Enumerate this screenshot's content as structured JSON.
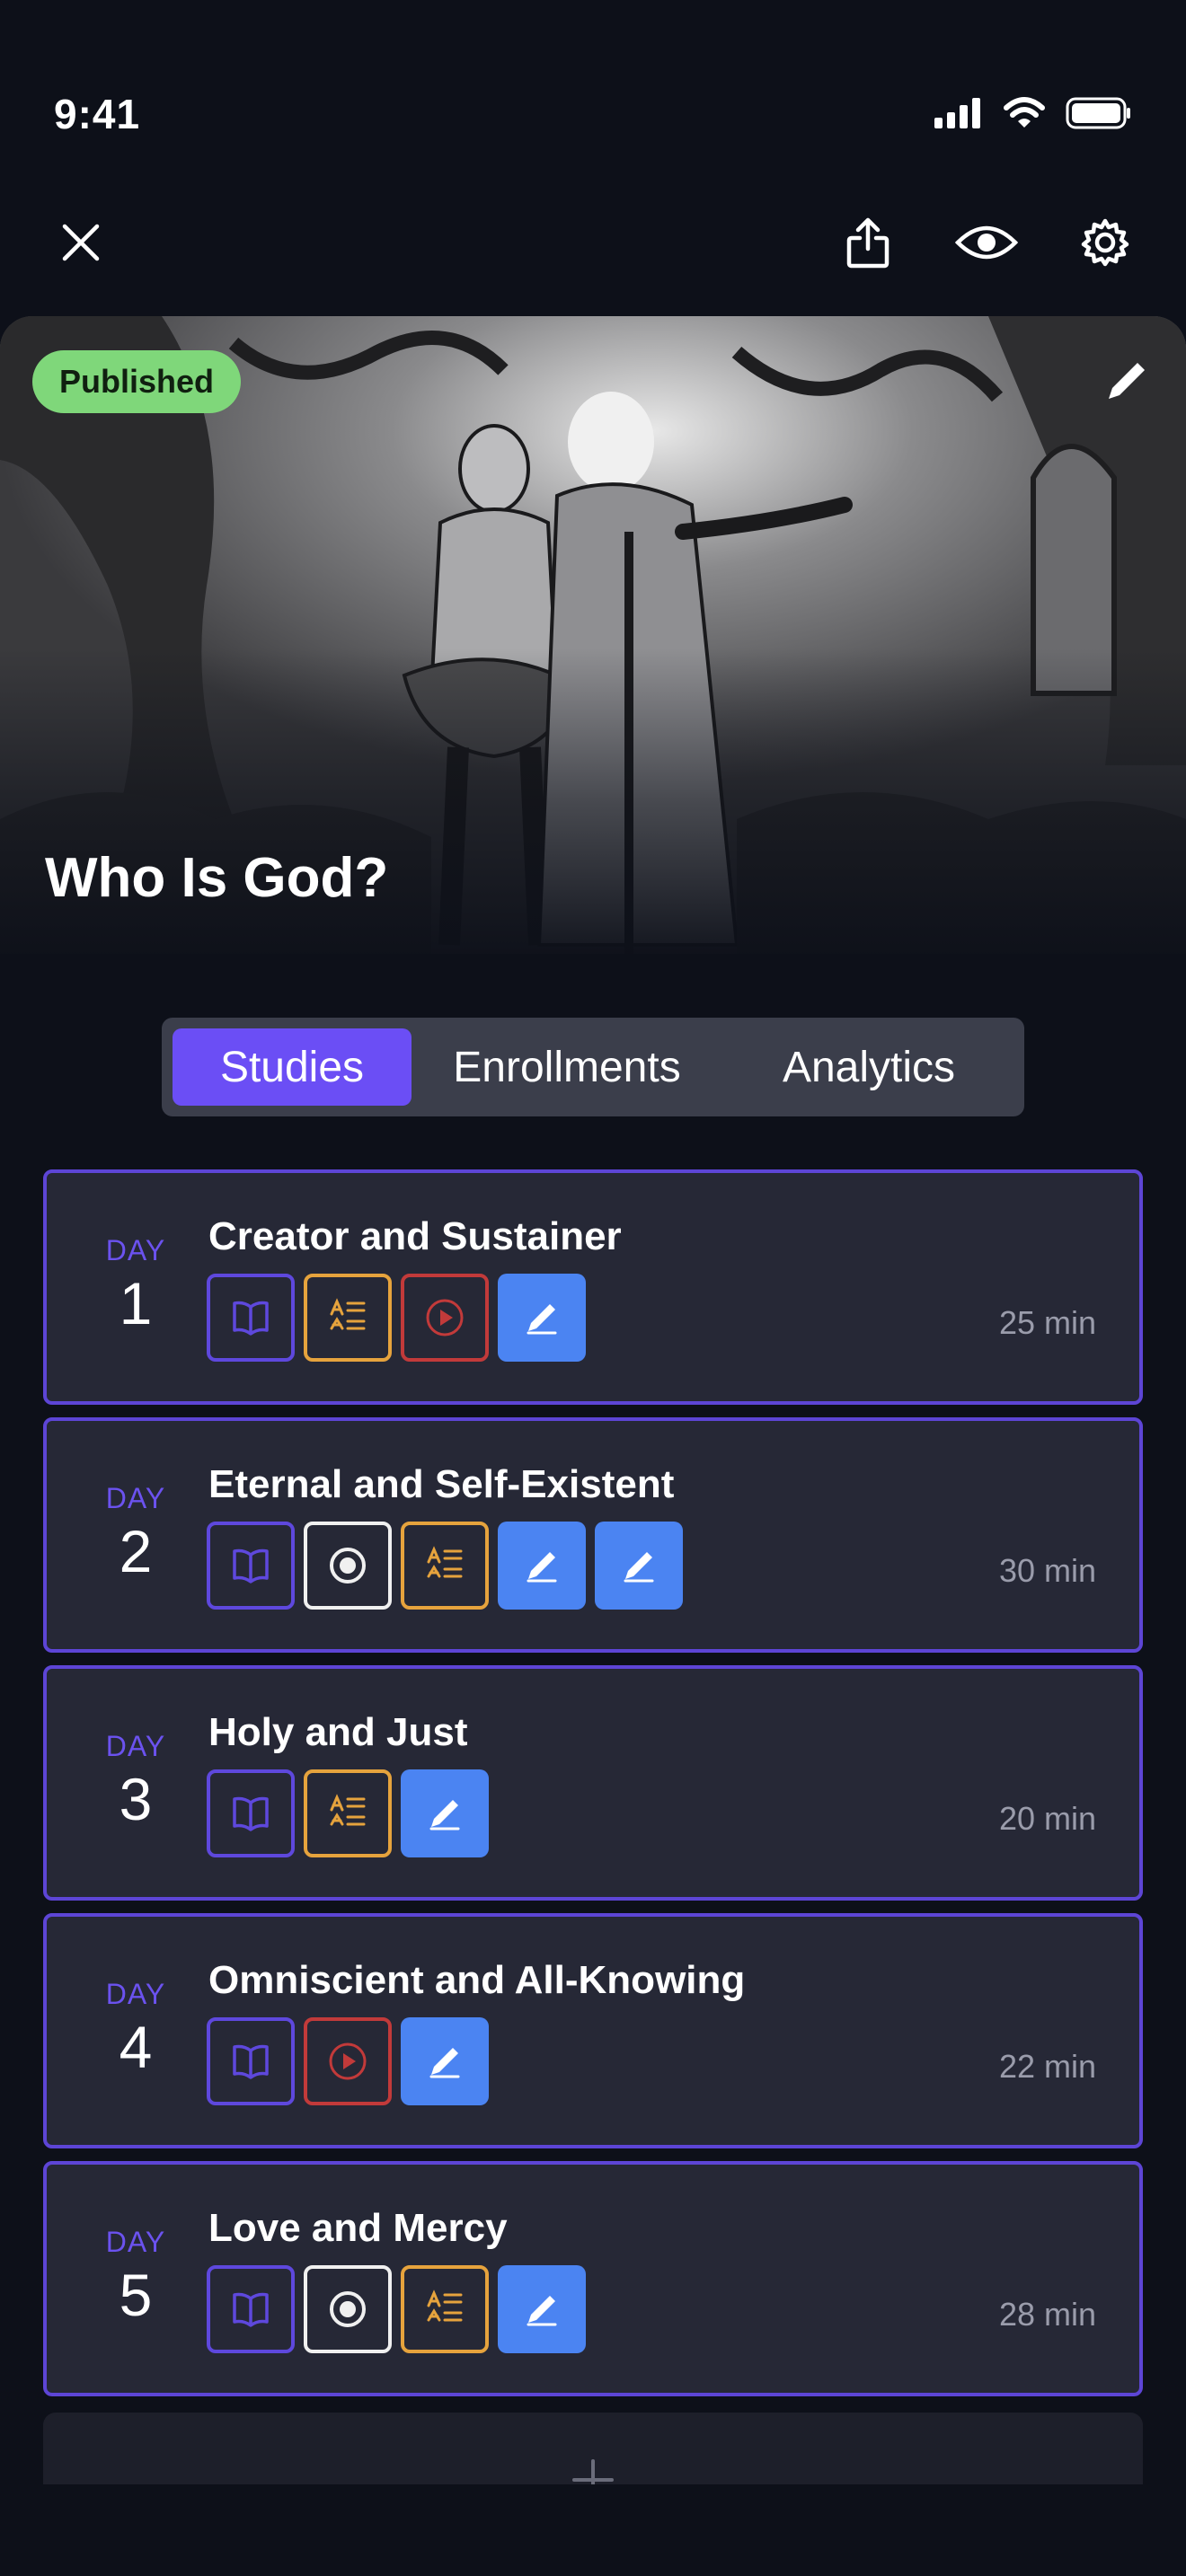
{
  "status_bar": {
    "time": "9:41",
    "icons": [
      "signal-icon",
      "wifi-icon",
      "battery-icon"
    ]
  },
  "toolbar": {
    "icons": [
      "close-icon",
      "share-icon",
      "eye-icon",
      "gear-icon"
    ]
  },
  "hero": {
    "status_badge": "Published",
    "title": "Who Is God?",
    "edit_icon": "pencil-icon"
  },
  "tabs": [
    {
      "label": "Studies",
      "active": true
    },
    {
      "label": "Enrollments",
      "active": false
    },
    {
      "label": "Analytics",
      "active": false
    }
  ],
  "days": [
    {
      "day_label": "DAY",
      "number": "1",
      "title": "Creator and Sustainer",
      "activities": [
        "read",
        "text",
        "video",
        "write"
      ],
      "duration": "25 min"
    },
    {
      "day_label": "DAY",
      "number": "2",
      "title": "Eternal and Self-Existent",
      "activities": [
        "read",
        "record",
        "text",
        "write",
        "write"
      ],
      "duration": "30 min"
    },
    {
      "day_label": "DAY",
      "number": "3",
      "title": "Holy and Just",
      "activities": [
        "read",
        "text",
        "write"
      ],
      "duration": "20 min"
    },
    {
      "day_label": "DAY",
      "number": "4",
      "title": "Omniscient and All-Knowing",
      "activities": [
        "read",
        "video",
        "write"
      ],
      "duration": "22 min"
    },
    {
      "day_label": "DAY",
      "number": "5",
      "title": "Love and Mercy",
      "activities": [
        "read",
        "record",
        "text",
        "write"
      ],
      "duration": "28 min"
    }
  ],
  "activity_icons": {
    "read": "book-icon",
    "text": "text-icon",
    "video": "play-icon",
    "record": "record-icon",
    "write": "pencil-icon"
  },
  "colors": {
    "accent": "#6b4ef5",
    "card_border": "#5d45d6",
    "published": "#7fd77a",
    "read": "#5e48dd",
    "text": "#e6a33d",
    "video": "#c23a3a",
    "write": "#4b84f2"
  },
  "add_day_icon": "plus-icon"
}
